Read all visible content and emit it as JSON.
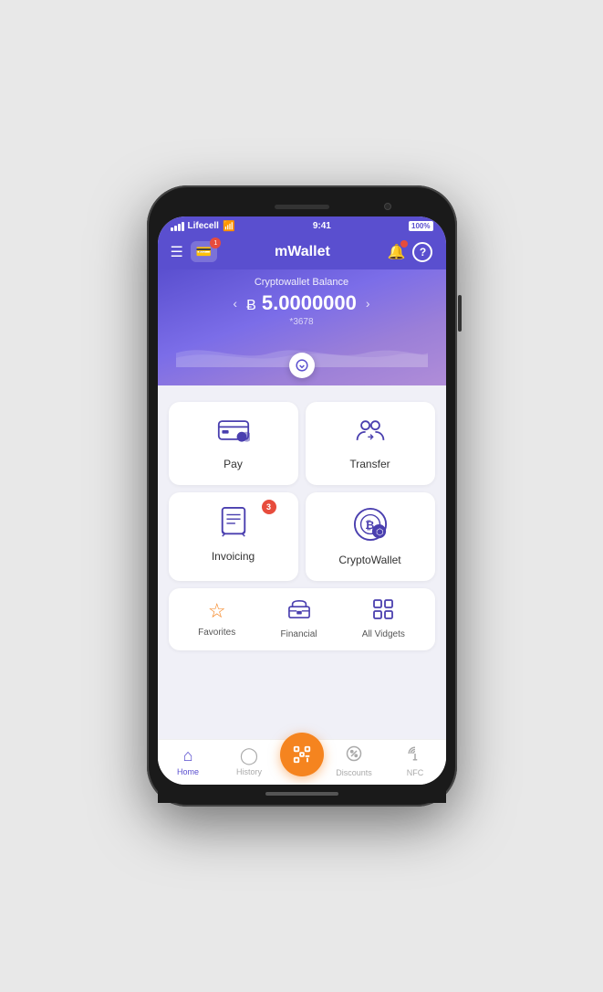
{
  "status": {
    "carrier": "Lifecell",
    "time": "9:41",
    "battery": "100%"
  },
  "header": {
    "title": "mWallet",
    "card_badge": "1"
  },
  "balance": {
    "label": "Cryptowallet Balance",
    "currency_symbol": "Ƀ",
    "amount": "5.0000000",
    "account": "*3678"
  },
  "actions": [
    {
      "id": "pay",
      "label": "Pay",
      "icon": "💳",
      "badge": null
    },
    {
      "id": "transfer",
      "label": "Transfer",
      "icon": "👥",
      "badge": null
    },
    {
      "id": "invoicing",
      "label": "Invoicing",
      "icon": "🧾",
      "badge": "3"
    },
    {
      "id": "cryptowallet",
      "label": "CryptoWallet",
      "icon": "₿",
      "badge": null
    }
  ],
  "widgets": [
    {
      "id": "favorites",
      "label": "Favorites",
      "icon": "☆",
      "color": "orange"
    },
    {
      "id": "financial",
      "label": "Financial",
      "icon": "🏛",
      "color": "blue"
    },
    {
      "id": "all-vidgets",
      "label": "All Vidgets",
      "icon": "⊞",
      "color": "blue"
    }
  ],
  "nav": [
    {
      "id": "home",
      "label": "Home",
      "active": true
    },
    {
      "id": "history",
      "label": "History",
      "active": false
    },
    {
      "id": "scan",
      "label": "",
      "center": true
    },
    {
      "id": "discounts",
      "label": "Discounts",
      "active": false
    },
    {
      "id": "nfc",
      "label": "NFC",
      "active": false
    }
  ]
}
